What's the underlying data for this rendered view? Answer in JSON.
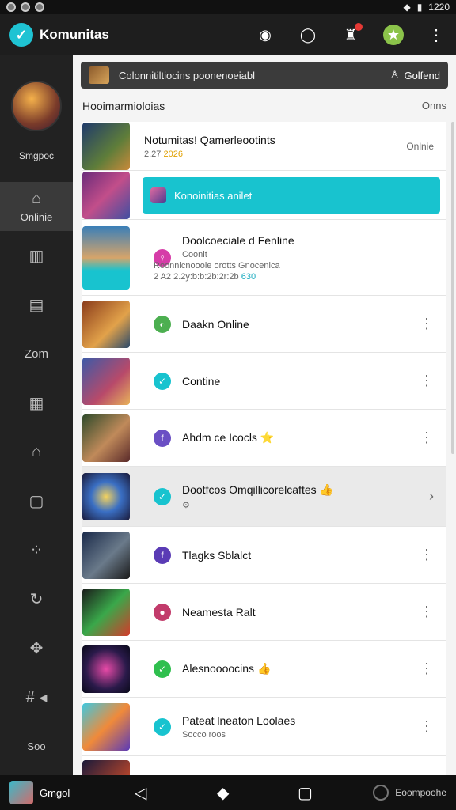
{
  "status_bar": {
    "time": "1220"
  },
  "app": {
    "title": "Komunitas"
  },
  "sidebar": {
    "profile_name": "Smgpoc",
    "items": [
      {
        "label": "Onlinie",
        "icon": "home-icon",
        "active": true
      },
      {
        "label": "",
        "icon": "book-icon"
      },
      {
        "label": "",
        "icon": "grid-icon"
      },
      {
        "label": "Zom",
        "icon": ""
      },
      {
        "label": "",
        "icon": "news-icon"
      },
      {
        "label": "",
        "icon": "house-icon"
      },
      {
        "label": "",
        "icon": "square-icon"
      },
      {
        "label": "",
        "icon": "group-icon"
      },
      {
        "label": "",
        "icon": "refresh-icon"
      },
      {
        "label": "",
        "icon": "puzzle-icon"
      },
      {
        "label": "",
        "icon": "hash-icon"
      },
      {
        "label": "Soo",
        "icon": ""
      }
    ]
  },
  "search": {
    "text": "Colonnitiltiocins poonenoeiabl",
    "right_label": "Golfend"
  },
  "list_header": {
    "left": "Hooimarmioloias",
    "right": "Onns"
  },
  "join_bar": {
    "label": "Konoinitias anilet"
  },
  "rows": [
    {
      "title": "Notumitas! Qamerleootints",
      "sub": "2.27",
      "sub_hl": "2026",
      "status": "Onlnie"
    },
    {
      "title": "",
      "sub": "",
      "is_join_row": true
    },
    {
      "title": "Doolcoeciale d Fenline",
      "sub": "Coonit",
      "sub2": "Roonnicnoooie orotts Gnocenica",
      "sub3": "2 A2 2.2y:b:b:2b:2r:2b",
      "sub3_hl": "630",
      "icon_color": "#d63ca8"
    },
    {
      "title": "Daakn Online",
      "icon_color": "#4caf50"
    },
    {
      "title": "Contine",
      "icon_color": "#18c3cf"
    },
    {
      "title": "Ahdm ce Icocls ⭐",
      "icon_color": "#6a4fc4"
    },
    {
      "title": "Dootfcos Omqillicorelcaftes 👍",
      "sub": "⚙",
      "icon_color": "#18c3cf",
      "highlight": true
    },
    {
      "title": "Tlagks Sblalct",
      "icon_color": "#5a3bb5"
    },
    {
      "title": "Neamesta Ralt",
      "icon_color": "#c23b6b"
    },
    {
      "title": "Alesnoooocins 👍",
      "icon_color": "#2fbf4e"
    },
    {
      "title": "Pateat lneaton Loolaes",
      "sub": "Socco roos",
      "icon_color": "#18c3cf"
    }
  ],
  "bottom": {
    "name": "Gmgol",
    "right_label": "Eoompoohe"
  }
}
